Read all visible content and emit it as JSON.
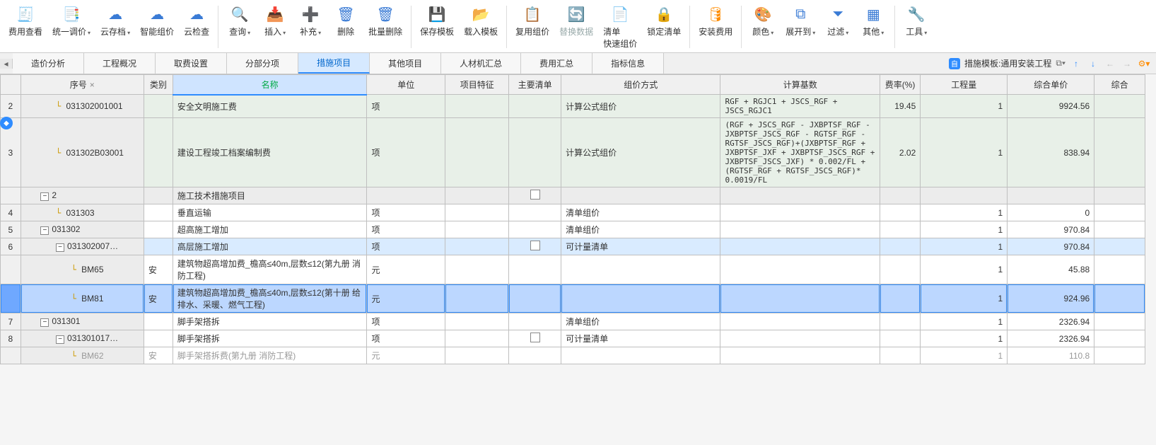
{
  "toolbar": [
    {
      "name": "fee-view",
      "label": "费用查看",
      "icon": "🧾",
      "color": "#3a7bd5"
    },
    {
      "name": "unify-price",
      "label": "统一调价",
      "icon": "📑",
      "color": "#3a7bd5",
      "drop": true
    },
    {
      "name": "cloud-save",
      "label": "云存档",
      "icon": "☁",
      "color": "#3a7bd5",
      "drop": true
    },
    {
      "name": "smart-price",
      "label": "智能组价",
      "icon": "☁",
      "color": "#3a7bd5"
    },
    {
      "name": "cloud-check",
      "label": "云检查",
      "icon": "☁",
      "color": "#3a7bd5"
    },
    {
      "sep": true
    },
    {
      "name": "query",
      "label": "查询",
      "icon": "🔍",
      "color": "#ff8c00",
      "drop": true
    },
    {
      "name": "insert",
      "label": "插入",
      "icon": "📥",
      "color": "#3a7bd5",
      "drop": true
    },
    {
      "name": "supplement",
      "label": "补充",
      "icon": "➕",
      "color": "#3a7bd5",
      "drop": true
    },
    {
      "name": "delete",
      "label": "删除",
      "icon": "🗑",
      "color": "#3a7bd5"
    },
    {
      "name": "batch-delete",
      "label": "批量删除",
      "icon": "🗑",
      "color": "#3a7bd5"
    },
    {
      "sep": true
    },
    {
      "name": "save-tpl",
      "label": "保存模板",
      "icon": "💾",
      "color": "#3a7bd5"
    },
    {
      "name": "load-tpl",
      "label": "载入模板",
      "icon": "📂",
      "color": "#ff8c00"
    },
    {
      "sep": true
    },
    {
      "name": "reuse-price",
      "label": "复用组价",
      "icon": "📋",
      "color": "#ff8c00"
    },
    {
      "name": "replace-data",
      "label": "替换数据",
      "icon": "🔄",
      "color": "#9aa"
    },
    {
      "name": "list-quick",
      "label": "清单\n快速组价",
      "icon": "📄",
      "color": "#3a7bd5"
    },
    {
      "name": "lock-list",
      "label": "锁定清单",
      "icon": "🔒",
      "color": "#3a7bd5"
    },
    {
      "sep": true
    },
    {
      "name": "install-fee",
      "label": "安装费用",
      "icon": "🛢",
      "color": "#ff8c00"
    },
    {
      "sep": true
    },
    {
      "name": "color",
      "label": "颜色",
      "icon": "🎨",
      "color": "#3a7bd5",
      "drop": true
    },
    {
      "name": "expand-to",
      "label": "展开到",
      "icon": "⧉",
      "color": "#3a7bd5",
      "drop": true
    },
    {
      "name": "filter",
      "label": "过滤",
      "icon": "⏷",
      "color": "#3a7bd5",
      "drop": true
    },
    {
      "name": "other",
      "label": "其他",
      "icon": "▦",
      "color": "#3a7bd5",
      "drop": true
    },
    {
      "sep": true
    },
    {
      "name": "tools",
      "label": "工具",
      "icon": "🔧",
      "color": "#3a7bd5",
      "drop": true
    }
  ],
  "tabs": {
    "items": [
      {
        "id": "cost-analysis",
        "label": "造价分析"
      },
      {
        "id": "proj-overview",
        "label": "工程概况"
      },
      {
        "id": "fee-settings",
        "label": "取费设置"
      },
      {
        "id": "section",
        "label": "分部分项"
      },
      {
        "id": "measure",
        "label": "措施项目",
        "active": true
      },
      {
        "id": "other-proj",
        "label": "其他项目"
      },
      {
        "id": "labor-summary",
        "label": "人材机汇总"
      },
      {
        "id": "fee-summary",
        "label": "费用汇总"
      },
      {
        "id": "index-info",
        "label": "指标信息"
      }
    ],
    "template_label": "措施模板:通用安装工程"
  },
  "columns": {
    "rownum": "",
    "seq": "序号",
    "cat": "类别",
    "name": "名称",
    "unit": "单位",
    "feat": "项目特征",
    "main": "主要清单",
    "mode": "组价方式",
    "base": "计算基数",
    "rate": "费率(%)",
    "qty": "工程量",
    "price": "综合单价",
    "total": "综合"
  },
  "rows": [
    {
      "n": "2",
      "seq": "031302001001",
      "seq_indent": 2,
      "cat": "",
      "name": "安全文明施工费",
      "unit": "项",
      "feat": "",
      "main": null,
      "mode": "计算公式组价",
      "base": "RGF + RGJC1 + JSCS_RGF + JSCS_RGJC1",
      "rate": "19.45",
      "qty": "1",
      "price": "9924.56",
      "style": "green"
    },
    {
      "n": "3",
      "seq": "031302B03001",
      "seq_indent": 2,
      "cat": "",
      "name": "建设工程竣工档案编制费",
      "unit": "项",
      "feat": "",
      "main": null,
      "mode": "计算公式组价",
      "base": "(RGF + JSCS_RGF - JXBPTSF_RGF - JXBPTSF_JSCS_RGF - RGTSF_RGF - RGTSF_JSCS_RGF)+(JXBPTSF_RGF + JXBPTSF_JXF + JXBPTSF_JSCS_RGF + JXBPTSF_JSCS_JXF) * 0.002/FL + (RGTSF_RGF + RGTSF_JSCS_RGF)* 0.0019/FL",
      "rate": "2.02",
      "qty": "1",
      "price": "838.94",
      "style": "green"
    },
    {
      "n": "",
      "seq": "2",
      "seq_indent": 1,
      "expander": "-",
      "cat": "",
      "name": "施工技术措施项目",
      "unit": "",
      "feat": "",
      "main": "chk",
      "mode": "",
      "base": "",
      "rate": "",
      "qty": "",
      "price": "",
      "style": "gray"
    },
    {
      "n": "4",
      "seq": "031303",
      "seq_indent": 2,
      "cat": "",
      "name": "垂直运输",
      "unit": "项",
      "feat": "",
      "main": null,
      "mode": "清单组价",
      "base": "",
      "rate": "",
      "qty": "1",
      "price": "0",
      "style": "plain"
    },
    {
      "n": "5",
      "seq": "031302",
      "seq_indent": 1,
      "expander": "-",
      "cat": "",
      "name": "超高施工增加",
      "unit": "项",
      "feat": "",
      "main": null,
      "mode": "清单组价",
      "base": "",
      "rate": "",
      "qty": "1",
      "price": "970.84",
      "style": "plain"
    },
    {
      "n": "6",
      "seq": "031302007…",
      "seq_indent": 2,
      "expander": "-",
      "cat": "",
      "name": "高层施工增加",
      "unit": "项",
      "feat": "",
      "main": "chk",
      "mode": "可计量清单",
      "base": "",
      "rate": "",
      "qty": "1",
      "price": "970.84",
      "style": "blue"
    },
    {
      "n": "",
      "seq": "BM65",
      "seq_indent": 3,
      "cat": "安",
      "name": "建筑物超高增加费_檐高≤40m,层数≤12(第九册 消防工程)",
      "unit": "元",
      "feat": "",
      "main": null,
      "mode": "",
      "base": "",
      "rate": "",
      "qty": "1",
      "price": "45.88",
      "style": "plain"
    },
    {
      "n": "",
      "seq": "BM81",
      "seq_indent": 3,
      "cat": "安",
      "name": "建筑物超高增加费_檐高≤40m,层数≤12(第十册 给排水、采暖、燃气工程)",
      "unit": "元",
      "feat": "",
      "main": null,
      "mode": "",
      "base": "",
      "rate": "",
      "qty": "1",
      "price": "924.96",
      "style": "sel"
    },
    {
      "n": "7",
      "seq": "031301",
      "seq_indent": 1,
      "expander": "-",
      "cat": "",
      "name": "脚手架搭拆",
      "unit": "项",
      "feat": "",
      "main": null,
      "mode": "清单组价",
      "base": "",
      "rate": "",
      "qty": "1",
      "price": "2326.94",
      "style": "plain"
    },
    {
      "n": "8",
      "seq": "031301017…",
      "seq_indent": 2,
      "expander": "-",
      "cat": "",
      "name": "脚手架搭拆",
      "unit": "项",
      "feat": "",
      "main": "chk",
      "mode": "可计量清单",
      "base": "",
      "rate": "",
      "qty": "1",
      "price": "2326.94",
      "style": "plain"
    },
    {
      "n": "",
      "seq": "BM62",
      "seq_indent": 3,
      "cat": "安",
      "name": "脚手架搭拆费(第九册 消防工程)",
      "unit": "元",
      "feat": "",
      "main": null,
      "mode": "",
      "base": "",
      "rate": "",
      "qty": "1",
      "price": "110.8",
      "style": "plain",
      "cut": true
    }
  ]
}
